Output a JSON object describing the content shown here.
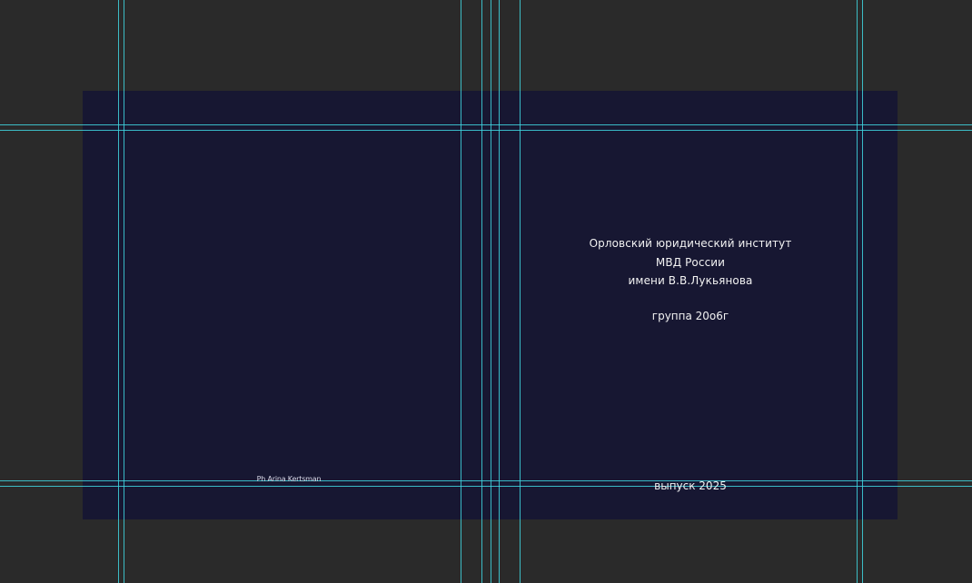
{
  "cover": {
    "institute_line1": "Орловский юридический институт",
    "institute_line2": "МВД России",
    "institute_line3": "имени В.В.Лукьянова",
    "group": "группа 20о6г",
    "year": "выпуск 2025",
    "photo_credit": "Ph Arina Kertsman"
  },
  "colors": {
    "canvas": "#2a2a2a",
    "artboard": "#171732",
    "guide": "#3fd6e0",
    "text": "#f2f2f2"
  }
}
